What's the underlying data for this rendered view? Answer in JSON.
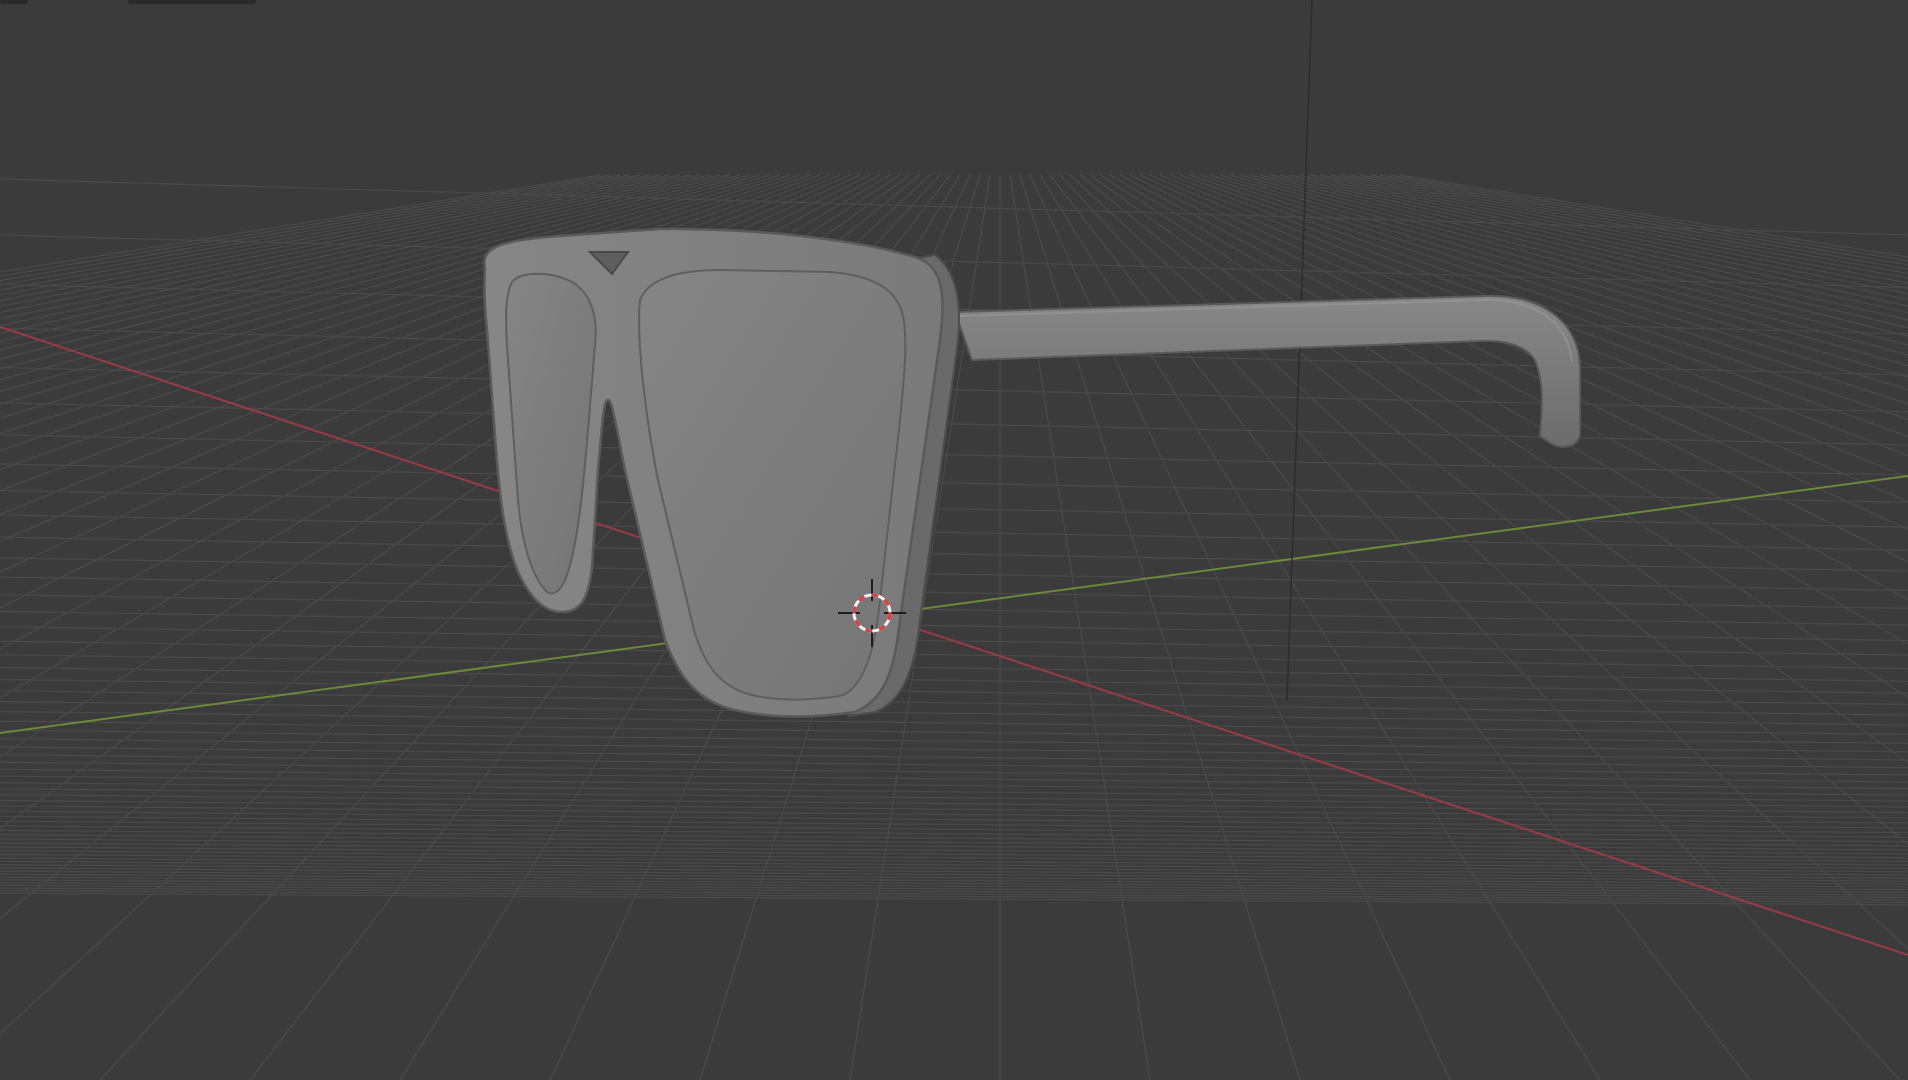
{
  "app": {
    "editor": "3D Viewport",
    "shading_mode": "solid"
  },
  "scene": {
    "object": "sunglasses-mesh",
    "cursor": "3d-cursor-icon",
    "floor_grid": true,
    "axes": [
      "x-axis",
      "y-axis",
      "z-axis"
    ]
  },
  "colors": {
    "background": "#3b3b3b",
    "grid": "#4a4a4a",
    "x_axis": "#9a3b45",
    "y_axis": "#6b8a37",
    "z_axis": "#2c2c2c",
    "mesh_face": "#7d7d7d",
    "mesh_light": "#8a8a8a",
    "mesh_edge": "#5a5a5a",
    "mesh_shadow": "#4e4e4e",
    "cursor_ring_red": "#e23b3b",
    "cursor_ring_white": "#f2f2f2"
  }
}
